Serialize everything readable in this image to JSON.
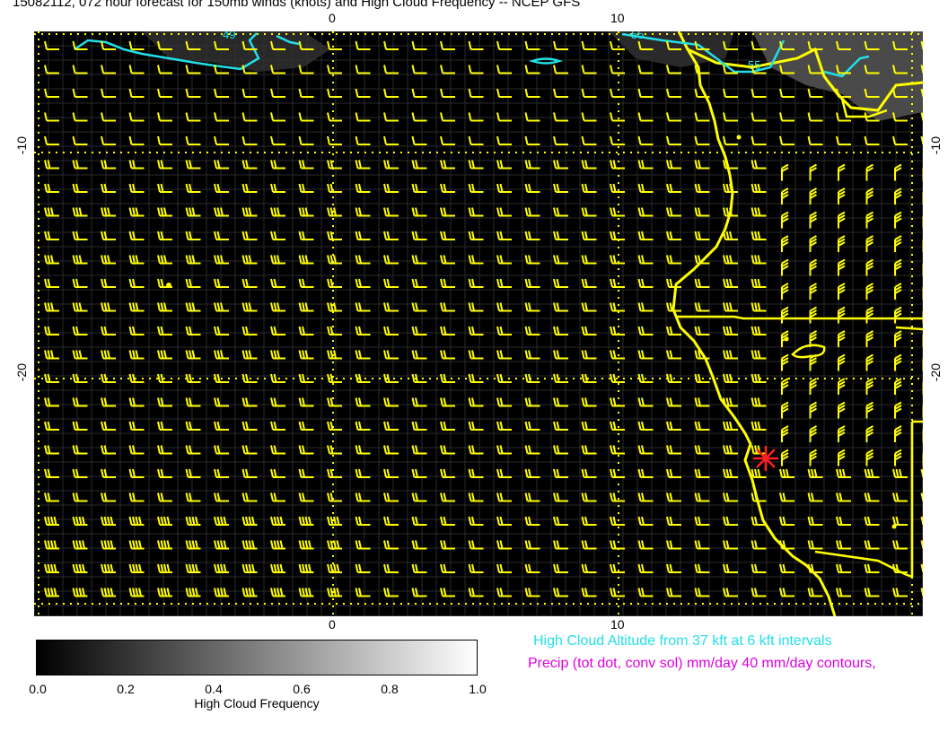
{
  "title": "15082112, 072 hour forecast for 150mb winds (knots) and High Cloud Frequency -- NCEP GFS",
  "axes": {
    "top_ticks": [
      "0",
      "10"
    ],
    "bottom_ticks": [
      "0",
      "10"
    ],
    "left_ticks": [
      "-10",
      "-20"
    ],
    "right_ticks": [
      "-10",
      "-20"
    ]
  },
  "contour_labels": [
    "49",
    "55",
    "55"
  ],
  "colorbar": {
    "ticks": [
      "0.0",
      "0.2",
      "0.4",
      "0.6",
      "0.8",
      "1.0"
    ],
    "label": "High Cloud Frequency",
    "range": [
      0.0,
      1.0
    ]
  },
  "legend": {
    "high_cloud_altitude": "High Cloud Altitude from 37 kft at 6 kft intervals",
    "precip": "Precip (tot dot, conv sol) mm/day 40 mm/day contours,"
  },
  "colors": {
    "barbs": "#ffff00",
    "coast": "#ffff00",
    "contour": "#22e0e8",
    "marker": "#ff2020",
    "background": "#000000"
  }
}
